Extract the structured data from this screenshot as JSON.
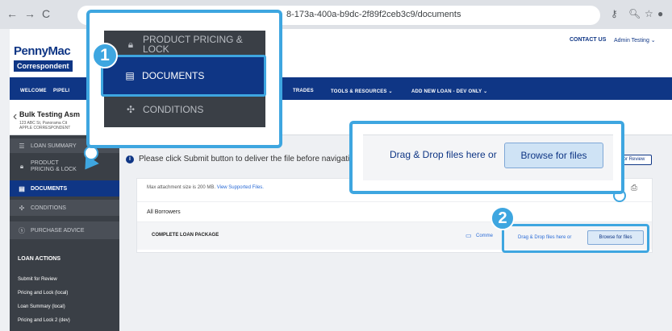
{
  "browser": {
    "url": "8-173a-400a-b9dc-2f89f2ceb3c9/documents",
    "back": "←",
    "forward": "→",
    "reload": "C"
  },
  "header": {
    "logo_top": "PennyMac",
    "logo_bottom": "Correspondent",
    "contact_us": "CONTACT US",
    "user_menu": "Admin Testing ⌄"
  },
  "nav": {
    "items": [
      "WELCOME",
      "PIPELI",
      "TRADES",
      "TOOLS & RESOURCES ⌄",
      "ADD NEW LOAN - DEV ONLY ⌄"
    ]
  },
  "loan": {
    "name": "Bulk Testing Asm",
    "address_line1": "123 ABC St, Panorama Cit",
    "address_line2": "APPLE CORRESPONDENT"
  },
  "sidebar": {
    "items": [
      {
        "label": "LOAN SUMMARY",
        "icon": "list-icon"
      },
      {
        "label": "PRODUCT PRICING & LOCK",
        "icon": "lock-icon"
      },
      {
        "label": "DOCUMENTS",
        "icon": "document-icon"
      },
      {
        "label": "CONDITIONS",
        "icon": "conditions-icon"
      },
      {
        "label": "PURCHASE ADVICE",
        "icon": "dollar-icon"
      }
    ],
    "actions_title": "LOAN ACTIONS",
    "actions": [
      "Submit for Review",
      "Pricing and Lock (local)",
      "Loan Summary (local)",
      "Pricing and Lock 2 (dev)"
    ]
  },
  "main": {
    "notice": "Please click Submit button to deliver the file before navigatin",
    "review_button": "or Review",
    "max_size": "Max attachment size is 200 MB.",
    "supported_link": "View Supported Files.",
    "all_borrowers": "All Borrowers",
    "package": "COMPLETE LOAN PACKAGE",
    "comment": "Comme",
    "drag_drop": "Drag & Drop files here or",
    "browse": "Browse for files"
  },
  "callout1": {
    "badge": "1",
    "items": [
      {
        "label": "PRODUCT PRICING & LOCK",
        "icon": "lock-icon"
      },
      {
        "label": "DOCUMENTS",
        "icon": "document-icon"
      },
      {
        "label": "CONDITIONS",
        "icon": "conditions-icon"
      }
    ]
  },
  "callout2": {
    "badge": "2",
    "drag_drop": "Drag & Drop files here or",
    "browse": "Browse for files"
  },
  "colors": {
    "brand": "#0f3685",
    "callout": "#3ea6e0",
    "sidebar": "#3a3f46"
  }
}
